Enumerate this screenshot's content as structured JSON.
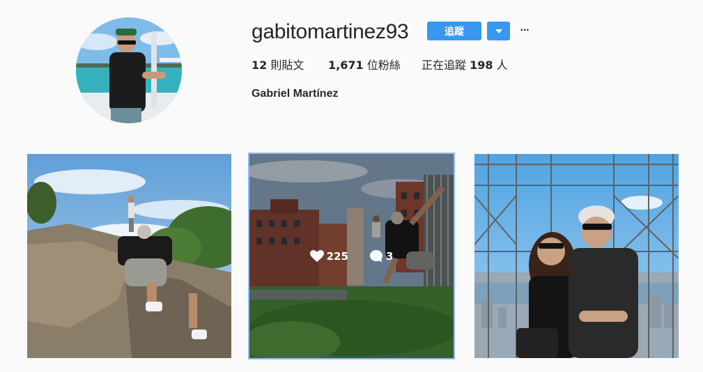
{
  "profile": {
    "username": "gabitomartinez93",
    "follow_label": "追蹤",
    "more_label": "···",
    "full_name": "Gabriel Martínez"
  },
  "stats": {
    "posts_count": "12",
    "posts_label": " 則貼文",
    "followers_count": "1,671",
    "followers_label": " 位粉絲",
    "following_prefix": "正在追蹤 ",
    "following_count": "198",
    "following_suffix": " 人"
  },
  "posts": [
    {
      "likes": "",
      "comments": ""
    },
    {
      "likes": "225",
      "comments": "3"
    },
    {
      "likes": "",
      "comments": ""
    }
  ],
  "colors": {
    "accent": "#3897f0",
    "background": "#fafafa",
    "text": "#262626"
  },
  "icons": {
    "dropdown": "triangle-down-icon",
    "more": "ellipsis-icon",
    "likes": "heart-icon",
    "comments": "speech-bubble-icon"
  }
}
